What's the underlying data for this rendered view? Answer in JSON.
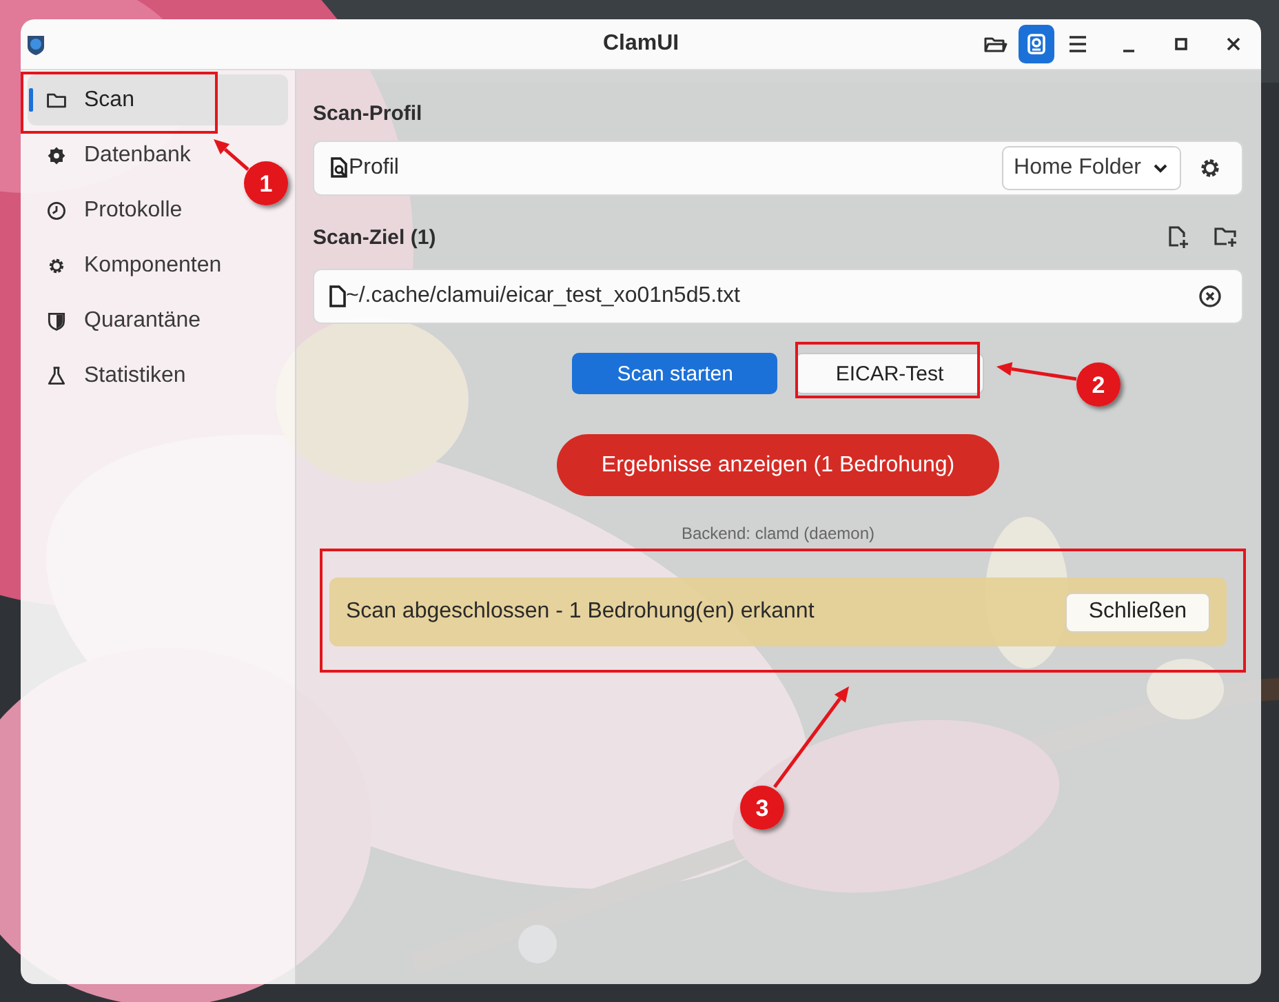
{
  "window": {
    "title": "ClamUI",
    "header_buttons": [
      {
        "kind": "folder",
        "selected": false
      },
      {
        "kind": "scan",
        "selected": true
      },
      {
        "kind": "menu",
        "selected": false
      }
    ]
  },
  "sidebar": {
    "items": [
      {
        "label": "Scan",
        "selected": true
      },
      {
        "label": "Datenbank",
        "selected": false
      },
      {
        "label": "Protokolle",
        "selected": false
      },
      {
        "label": "Komponenten",
        "selected": false
      },
      {
        "label": "Quarantäne",
        "selected": false
      },
      {
        "label": "Statistiken",
        "selected": false
      }
    ]
  },
  "scan_profile": {
    "heading": "Scan-Profil",
    "label": "Profil",
    "dropdown": "Home Folder"
  },
  "scan_target": {
    "heading": "Scan-Ziel (1)",
    "path": "~/.cache/clamui/eicar_test_xo01n5d5.txt"
  },
  "buttons": [
    {
      "label": "Scan starten",
      "kind": "primary"
    },
    {
      "label": "EICAR-Test",
      "kind": "secondary"
    }
  ],
  "results_button": "Ergebnisse anzeigen (1 Bedrohung)",
  "backend": "Backend: clamd (daemon)",
  "banner": {
    "message": "Scan abgeschlossen - 1 Bedrohung(en) erkannt",
    "button": "Schließen"
  },
  "annotations": [
    {
      "number": "1"
    },
    {
      "number": "2"
    },
    {
      "number": "3"
    }
  ]
}
